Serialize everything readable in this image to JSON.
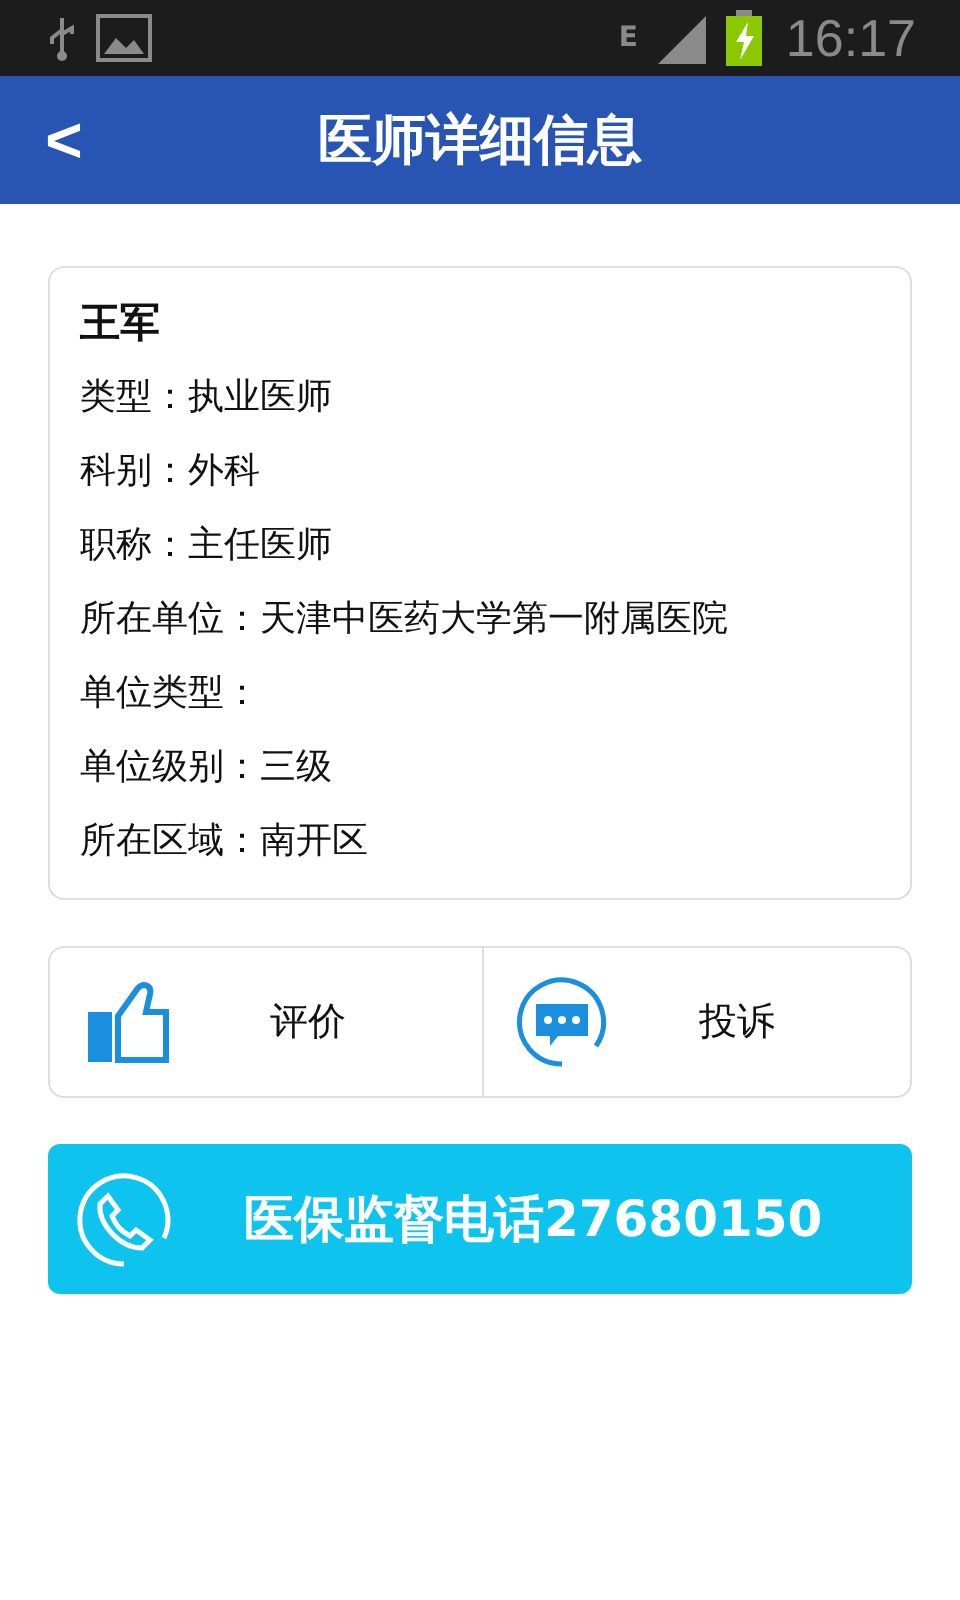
{
  "status_bar": {
    "network": "E",
    "time": "16:17"
  },
  "header": {
    "back": "<",
    "title": "医师详细信息"
  },
  "doctor": {
    "name": "王军",
    "fields": [
      "类型：执业医师",
      "科别：外科",
      "职称：主任医师",
      "所在单位：天津中医药大学第一附属医院",
      "单位类型：",
      "单位级别：三级",
      "所在区域：南开区"
    ]
  },
  "actions": [
    {
      "kind": "rate",
      "label": "评价"
    },
    {
      "kind": "complain",
      "label": "投诉"
    }
  ],
  "hotline": {
    "label": "医保监督电话27680150"
  }
}
